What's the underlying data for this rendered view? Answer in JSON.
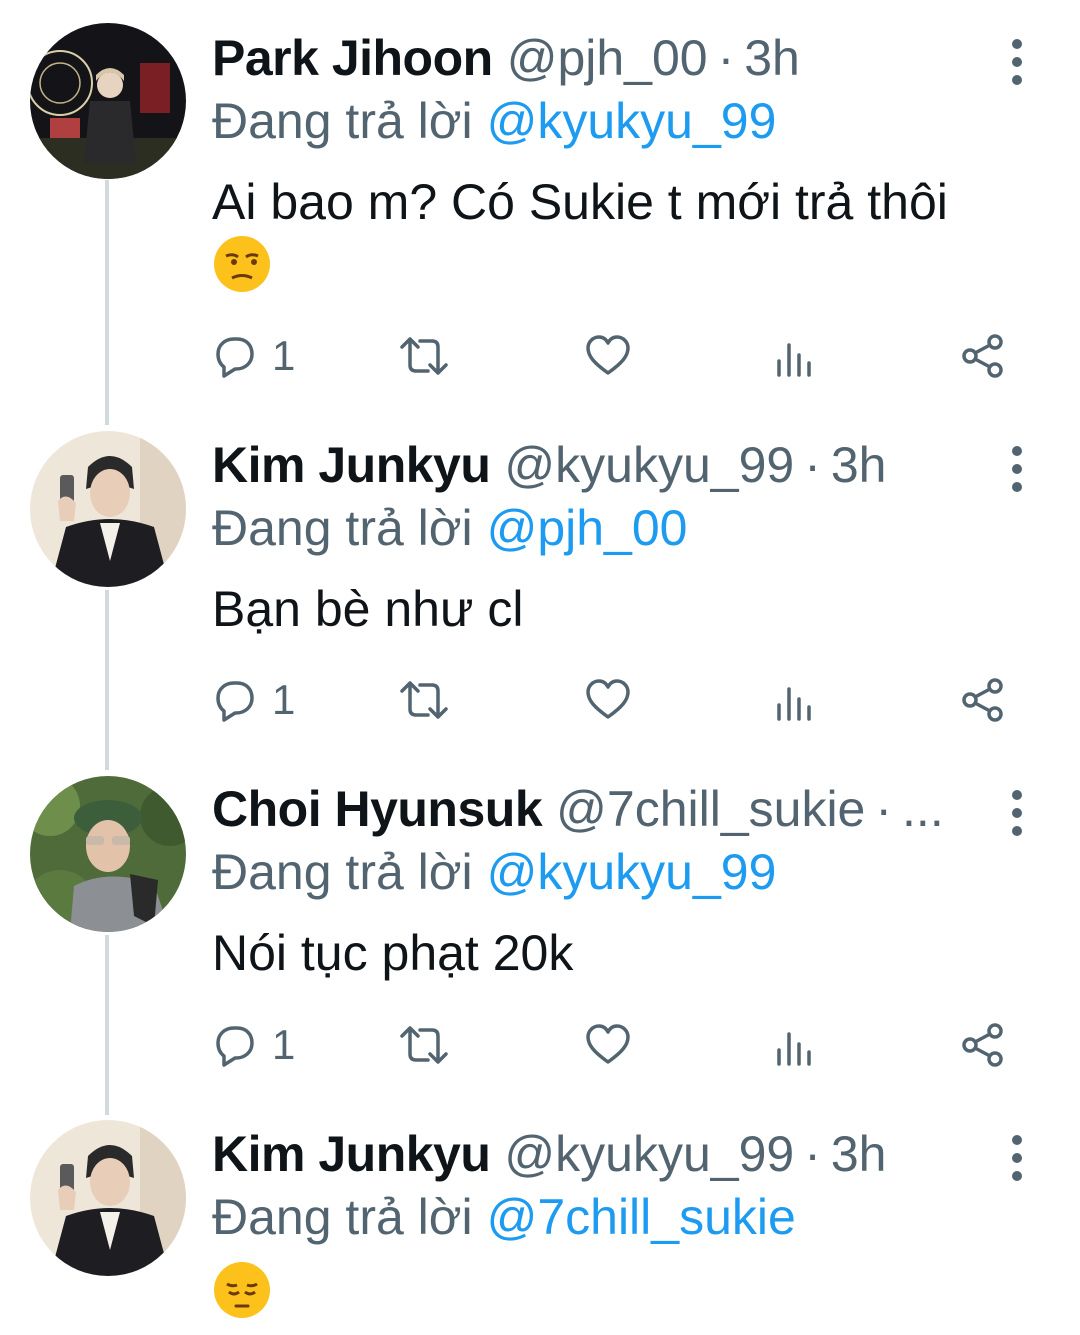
{
  "thread": {
    "replying_label": "Đang trả lời",
    "tweets": [
      {
        "name": "Park Jihoon",
        "handle": "@pjh_00",
        "separator": "·",
        "time": "3h",
        "reply_to": "@kyukyu_99",
        "text": "Ai bao m? Có Sukie t mới trả thôi",
        "emoji": "unamused-face-emoji",
        "reply_count": "1",
        "avatar": "avatar-night-fair"
      },
      {
        "name": "Kim Junkyu",
        "handle": "@kyukyu_99",
        "separator": "·",
        "time": "3h",
        "reply_to": "@pjh_00",
        "text": "Bạn bè như cl",
        "reply_count": "1",
        "avatar": "avatar-mirror-selfie"
      },
      {
        "name": "Choi Hyunsuk",
        "handle": "@7chill_sukie",
        "separator": "·",
        "time": "...",
        "reply_to": "@kyukyu_99",
        "text": "Nói tục phạt 20k",
        "reply_count": "1",
        "avatar": "avatar-green-beret"
      },
      {
        "name": "Kim Junkyu",
        "handle": "@kyukyu_99",
        "separator": "·",
        "time": "3h",
        "reply_to": "@7chill_sukie",
        "text": "",
        "emoji": "pensive-face-emoji",
        "avatar": "avatar-mirror-selfie"
      }
    ]
  },
  "colors": {
    "link": "#1d9bf0",
    "secondary": "#536471",
    "thread_line": "#cfd9de"
  }
}
